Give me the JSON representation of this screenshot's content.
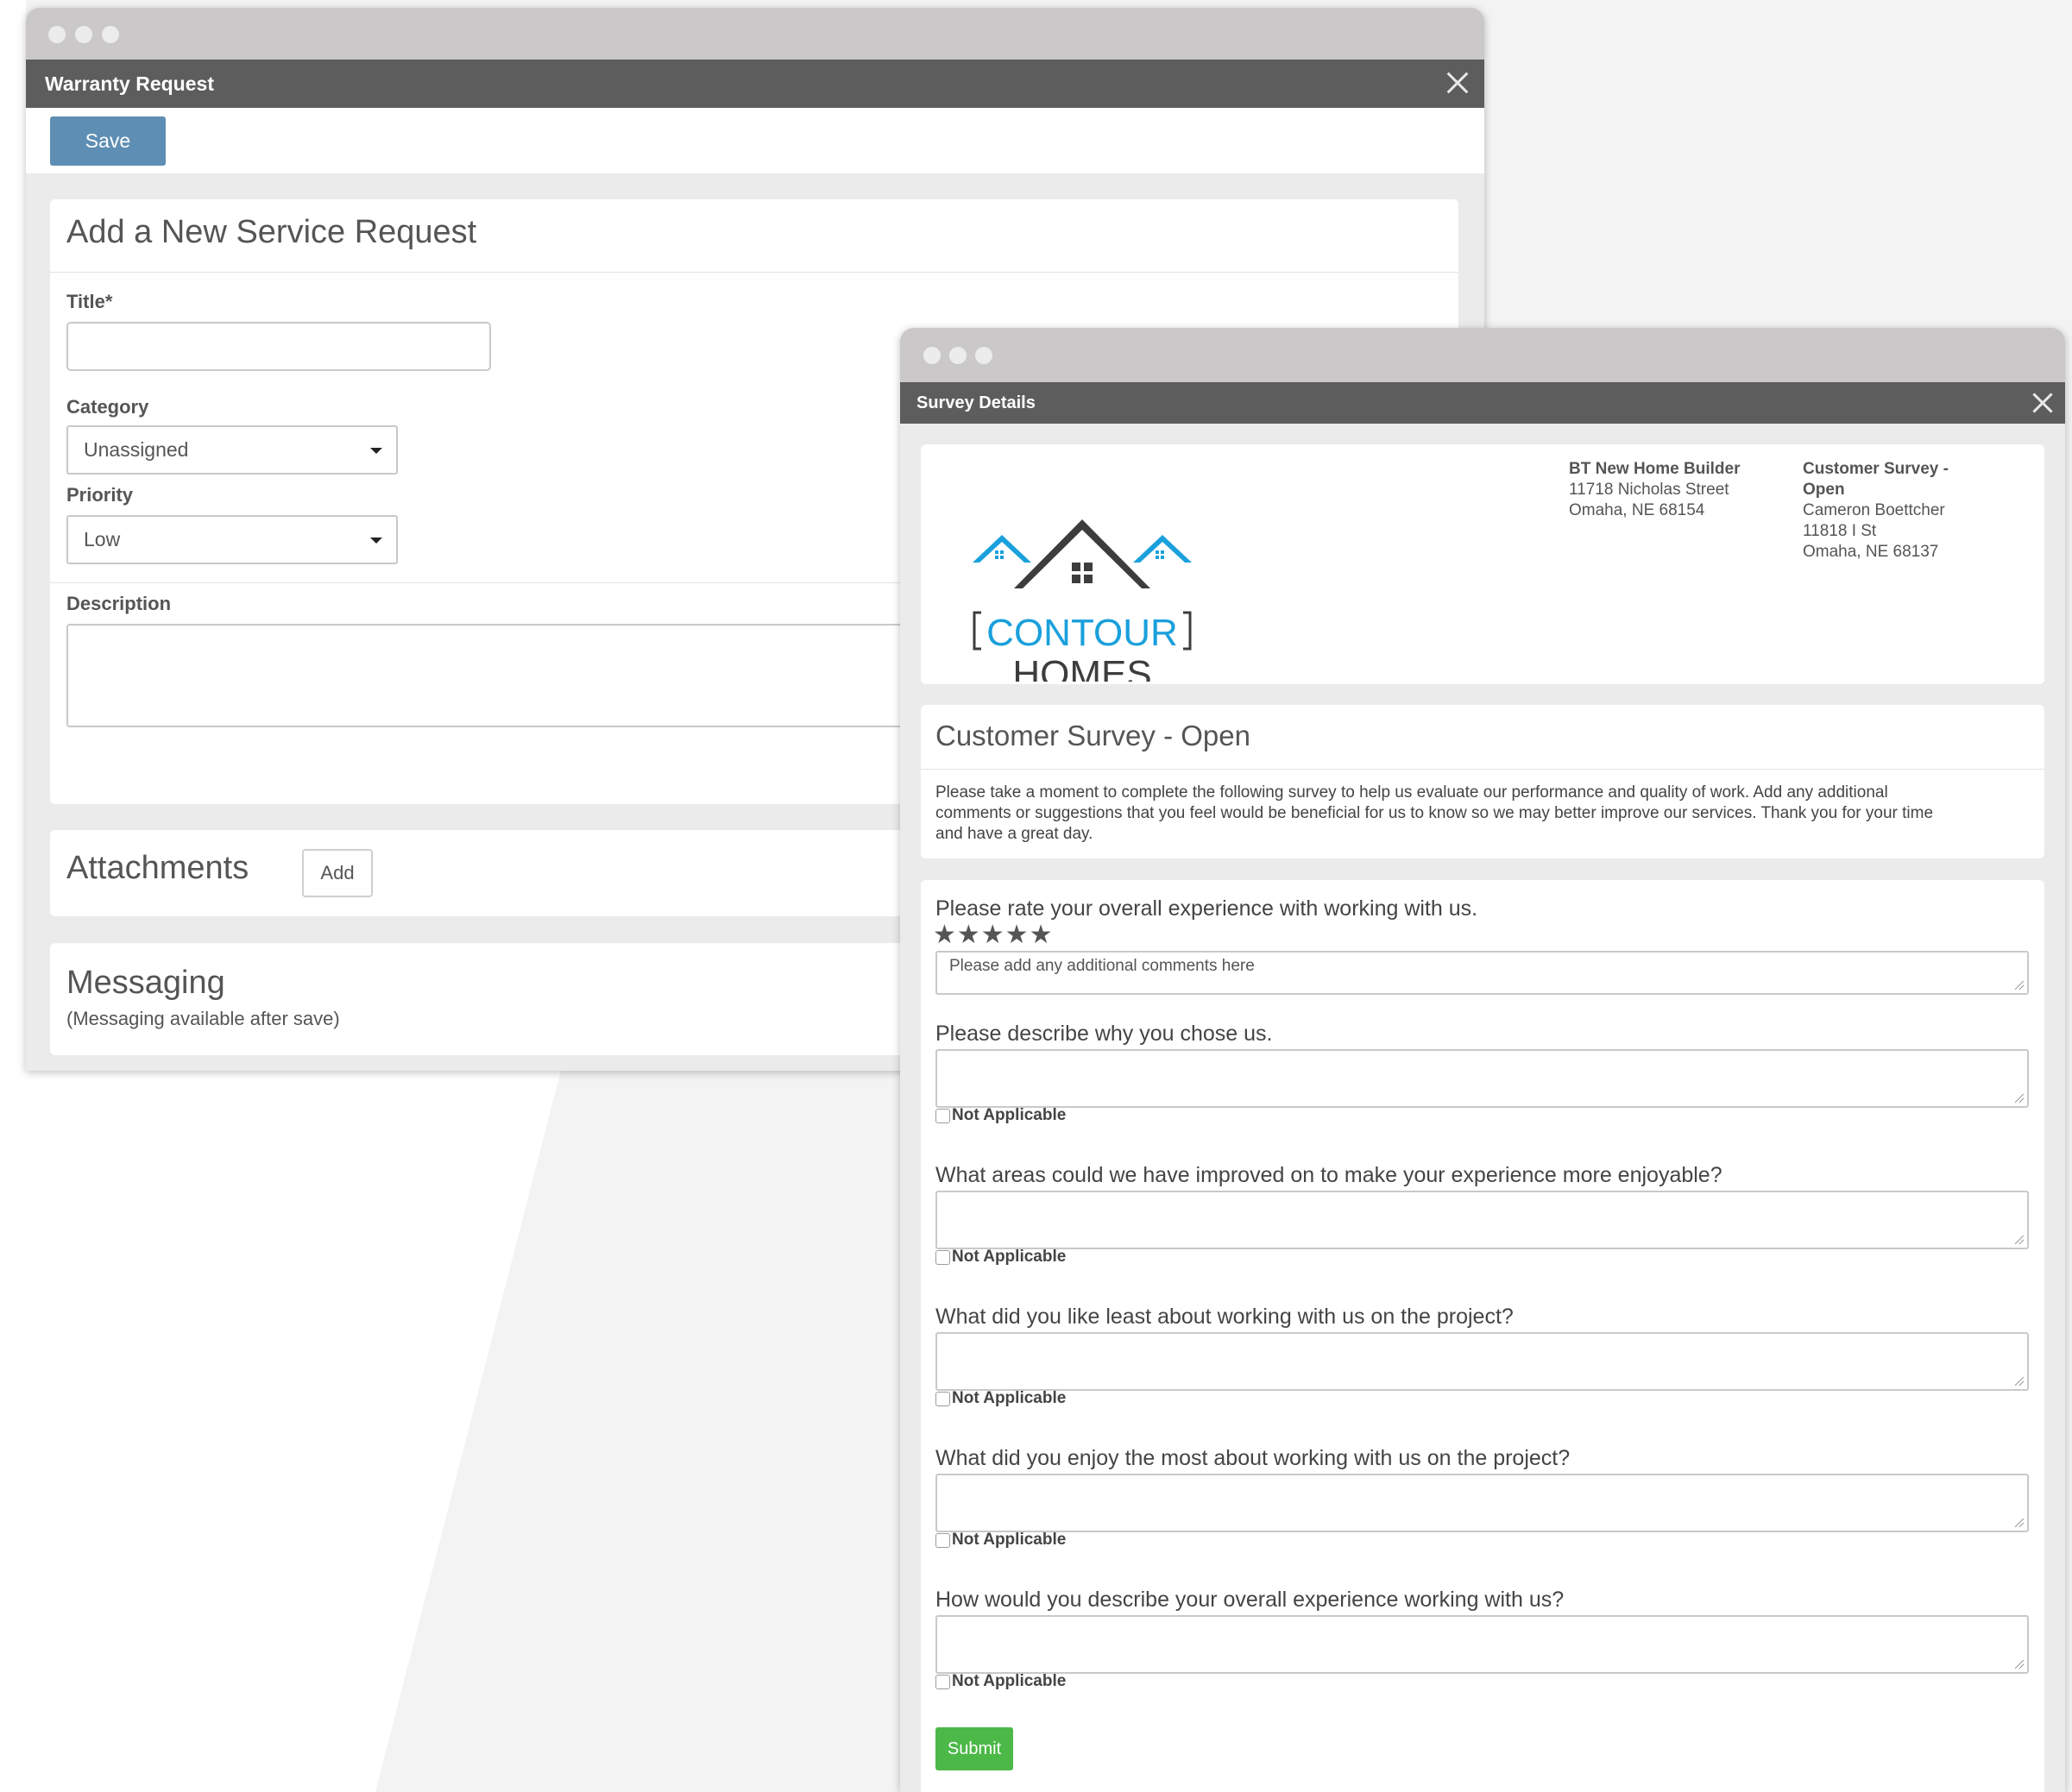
{
  "warranty": {
    "window_title": "Warranty Request",
    "save_label": "Save",
    "section_title": "Add a New Service Request",
    "title_label": "Title*",
    "title_value": "",
    "category_label": "Category",
    "category_value": "Unassigned",
    "priority_label": "Priority",
    "priority_value": "Low",
    "description_label": "Description",
    "attachments_title": "Attachments",
    "add_label": "Add",
    "messaging_title": "Messaging",
    "messaging_note": "(Messaging available after save)"
  },
  "survey": {
    "window_title": "Survey Details",
    "logo": {
      "line1": "CONTOUR",
      "line2": "HOMES",
      "primary_color": "#1aa0dc",
      "dark_color": "#3d3d3d"
    },
    "builder": {
      "name": "BT New Home Builder",
      "street": "11718 Nicholas Street",
      "city": "Omaha, NE 68154"
    },
    "customer": {
      "heading_line1": "Customer Survey -",
      "heading_line2": "Open",
      "name": "Cameron Boettcher",
      "street": "11818 I St",
      "city": "Omaha, NE 68137"
    },
    "title": "Customer Survey - Open",
    "intro_lines": [
      "Please take a moment to complete the following survey to help us evaluate our performance and quality of work. Add any additional",
      "comments or suggestions that you feel would be beneficial for us to know so we may better improve our services. Thank you for your time",
      "and have a great day."
    ],
    "rating_question": "Please rate your overall experience with working with us.",
    "rating_stars": "★★★★★",
    "rating_placeholder": "Please add any additional comments here",
    "not_applicable_label": "Not Applicable",
    "questions": [
      "Please describe why you chose us.",
      "What areas could we have improved on to make your experience more enjoyable?",
      "What did you like least about working with us on the project?",
      "What did you enjoy the most about working with us on the project?",
      "How would you describe your overall experience working with us?"
    ],
    "submit_label": "Submit"
  }
}
